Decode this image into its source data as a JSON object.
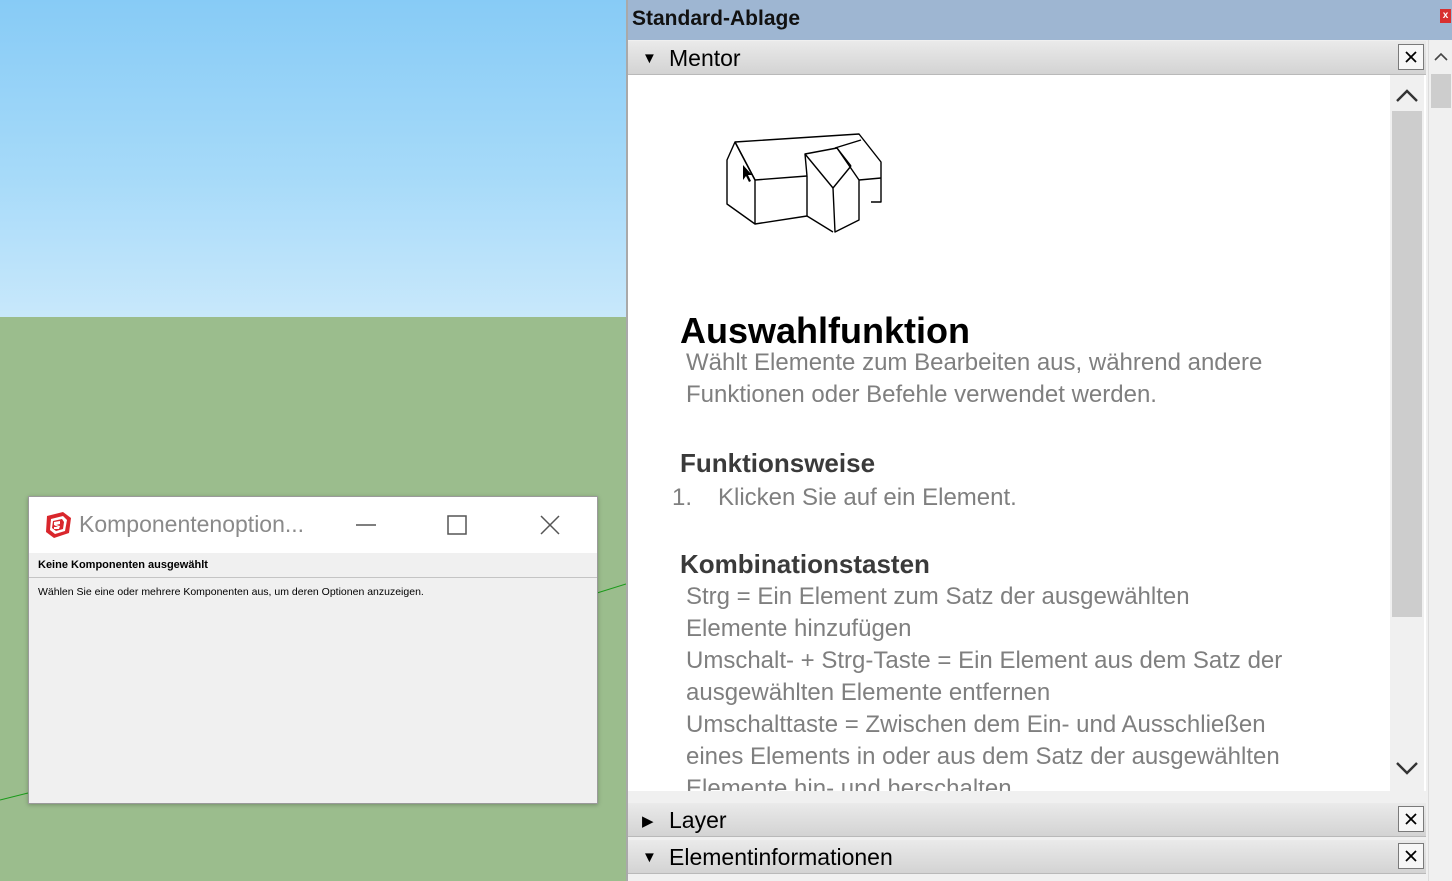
{
  "dialog": {
    "title": "Komponentenoption...",
    "subtitle": "Keine Komponenten ausgewählt",
    "body": "Wählen Sie eine oder mehrere Komponenten aus, um deren Optionen anzuzeigen."
  },
  "tray": {
    "title": "Standard-Ablage",
    "close_label": "x"
  },
  "panels": {
    "mentor": {
      "label": "Mentor",
      "expanded": true
    },
    "layer": {
      "label": "Layer",
      "expanded": false
    },
    "entity_info": {
      "label": "Elementinformationen",
      "expanded": true
    }
  },
  "mentor": {
    "title": "Auswahlfunktion",
    "description_1": "Wählt Elemente zum Bearbeiten aus, während andere",
    "description_2": "Funktionen oder Befehle verwendet werden.",
    "section_1": "Funktionsweise",
    "step_number": "1.",
    "step_text": "Klicken Sie auf ein Element.",
    "section_2": "Kombinationstasten",
    "keys_line_1": "Strg = Ein Element zum Satz der ausgewählten",
    "keys_line_2": "Elemente hinzufügen",
    "keys_line_3": "Umschalt- + Strg-Taste = Ein Element aus dem Satz der",
    "keys_line_4": "ausgewählten Elemente entfernen",
    "keys_line_5": "Umschalttaste = Zwischen dem Ein- und Ausschließen",
    "keys_line_6": "eines Elements in oder aus dem Satz der ausgewählten",
    "keys_line_7": "Elemente hin- und herschalten"
  },
  "colors": {
    "sky_top": "#87cbf6",
    "ground": "#9bbd8d",
    "tray_header": "#9eb6d2",
    "mentor_text": "#7f7f7f"
  },
  "icons": {
    "app_logo": "sketchup-logo-icon",
    "collapse": "triangle-down-icon",
    "expand": "triangle-right-icon",
    "close": "close-icon"
  }
}
